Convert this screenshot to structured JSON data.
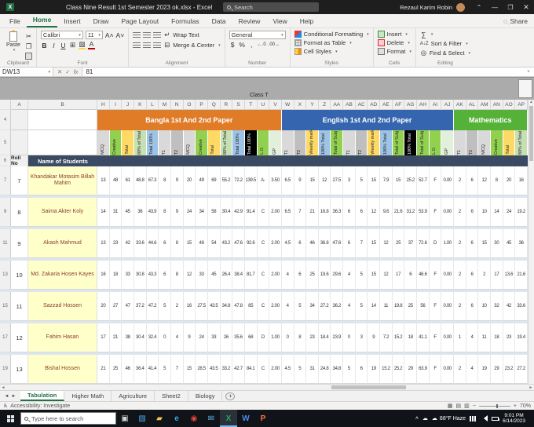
{
  "titlebar": {
    "title": "Class Nine Result 1st Semester 2023 ok.xlsx - Excel",
    "search": "Search",
    "user": "Rezaul Karim Robin"
  },
  "ribbon": {
    "tabs": [
      "File",
      "Home",
      "Insert",
      "Draw",
      "Page Layout",
      "Formulas",
      "Data",
      "Review",
      "View",
      "Help"
    ],
    "active_tab": "Home",
    "share_label": "Share",
    "group_labels": [
      "Clipboard",
      "Font",
      "Alignment",
      "Number",
      "Styles",
      "Cells",
      "Editing"
    ],
    "paste_label": "Paste",
    "font_name": "Calibri",
    "font_size": "11",
    "wrap_text_label": "Wrap Text",
    "merge_center_label": "Merge & Center",
    "number_format": "General",
    "cond_fmt_label": "Conditional Formatting",
    "format_table_label": "Format as Table",
    "cell_styles_label": "Cell Styles",
    "insert_label": "Insert",
    "delete_label": "Delete",
    "format_label": "Format",
    "sort_filter_label": "Sort & Filter",
    "find_select_label": "Find & Select"
  },
  "formula_bar": {
    "name_box": "DW13",
    "value": "81"
  },
  "sheet": {
    "left_cols": [
      "A",
      "B"
    ],
    "gutter_numbers": [
      "4",
      "5",
      "6"
    ],
    "floating_text": "Class T",
    "col_letters": [
      "H",
      "I",
      "J",
      "K",
      "L",
      "M",
      "N",
      "O",
      "P",
      "Q",
      "R",
      "S",
      "T",
      "U",
      "V",
      "W",
      "X",
      "Y",
      "Z",
      "AA",
      "AB",
      "AC",
      "AD",
      "AE",
      "AF",
      "AG",
      "AH",
      "AI",
      "AJ",
      "AK",
      "AL",
      "AM",
      "AN",
      "AO",
      "AP"
    ],
    "bands": [
      {
        "label": "Bangla 1st And 2nd Paper",
        "color": "#e07b28",
        "span": 15
      },
      {
        "label": "English 1st And 2nd Paper",
        "color": "#3565ae",
        "span": 14
      },
      {
        "label": "Mathematics",
        "color": "#55b138",
        "span": 6
      }
    ],
    "sub_headers": [
      {
        "label": "MCQ",
        "bg": "#d9d9d9"
      },
      {
        "label": "Creative",
        "bg": "#92d050"
      },
      {
        "label": "Total",
        "bg": "#ffd966"
      },
      {
        "label": "80% of Total",
        "bg": "#c6e0b4"
      },
      {
        "label": "Total 100%",
        "bg": "#9dc3e6"
      },
      {
        "label": "T1",
        "bg": "#d9d9d9"
      },
      {
        "label": "T2",
        "bg": "#bfbfbf"
      },
      {
        "label": "MCQ",
        "bg": "#d9d9d9"
      },
      {
        "label": "Creative",
        "bg": "#92d050"
      },
      {
        "label": "Total",
        "bg": "#ffd966"
      },
      {
        "label": "80% of Total",
        "bg": "#c6e0b4"
      },
      {
        "label": "Total 100%",
        "bg": "#9dc3e6"
      },
      {
        "label": "Total 100%",
        "bg": "#000000",
        "fg": "#ffffff"
      },
      {
        "label": "L.G",
        "bg": "#92d050"
      },
      {
        "label": "GP",
        "bg": "#e2efda"
      },
      {
        "label": "T1",
        "bg": "#d9d9d9"
      },
      {
        "label": "T2",
        "bg": "#bfbfbf"
      },
      {
        "label": "Weekly mark",
        "bg": "#ffd966"
      },
      {
        "label": "100% Total",
        "bg": "#9dc3e6"
      },
      {
        "label": "Total of Subj",
        "bg": "#92d050"
      },
      {
        "label": "T1",
        "bg": "#d9d9d9"
      },
      {
        "label": "T2",
        "bg": "#bfbfbf"
      },
      {
        "label": "Weekly mark",
        "bg": "#ffd966"
      },
      {
        "label": "100% Total",
        "bg": "#9dc3e6"
      },
      {
        "label": "Total of Subj",
        "bg": "#92d050"
      },
      {
        "label": "100% Total",
        "bg": "#000000",
        "fg": "#ffffff"
      },
      {
        "label": "Total of Subj",
        "bg": "#92d050"
      },
      {
        "label": "L.G",
        "bg": "#92d050"
      },
      {
        "label": "GP",
        "bg": "#e2efda"
      },
      {
        "label": "T1",
        "bg": "#d9d9d9"
      },
      {
        "label": "T2",
        "bg": "#bfbfbf"
      },
      {
        "label": "MCQ",
        "bg": "#d9d9d9"
      },
      {
        "label": "Creative",
        "bg": "#92d050"
      },
      {
        "label": "Total",
        "bg": "#ffd966"
      },
      {
        "label": "80% of Total",
        "bg": "#c6e0b4"
      }
    ],
    "header_row": {
      "roll": "Roll No",
      "name": "Name of Students"
    },
    "rows": [
      {
        "num": "7",
        "roll": "7",
        "name": "Khandakar Motasim Billah Mahim",
        "values": [
          13,
          48,
          61,
          48.8,
          67.3,
          8,
          9,
          20,
          49,
          69,
          55.2,
          72.2,
          139.5,
          "A-",
          "3.50",
          6.5,
          9,
          15,
          12,
          27.5,
          3,
          5,
          15,
          7.9,
          15,
          25.2,
          52.7,
          "F",
          "0.00",
          2,
          6,
          12,
          8,
          20,
          16
        ]
      },
      {
        "num": "9",
        "roll": "8",
        "name": "Saima Akter Koly",
        "values": [
          14,
          31,
          45,
          36,
          43.9,
          8,
          9,
          24,
          34,
          58,
          30.4,
          42.9,
          91.4,
          "C",
          "2.00",
          6.5,
          7,
          21,
          16.8,
          36.3,
          6,
          6,
          12,
          9.6,
          21.6,
          31.2,
          53.9,
          "F",
          "0.00",
          2,
          6,
          10,
          14,
          24,
          19.2
        ]
      },
      {
        "num": "11",
        "roll": "9",
        "name": "Akash Mahmud",
        "values": [
          13,
          23,
          42,
          33.6,
          44.6,
          6,
          8,
          15,
          48,
          54,
          43.2,
          47.6,
          92.6,
          "C",
          "2.00",
          4.5,
          6,
          46,
          36.8,
          47.6,
          6,
          7,
          15,
          12,
          25,
          37,
          72.6,
          "D",
          "1.00",
          2,
          6,
          15,
          30,
          45,
          36
        ]
      },
      {
        "num": "13",
        "roll": "10",
        "name": "Md. Zakaria Hosen Kayes",
        "values": [
          16,
          18,
          33,
          30.8,
          43.3,
          6,
          8,
          12,
          33,
          45,
          26.4,
          38.4,
          81.7,
          "C",
          "2.00",
          4,
          6,
          25,
          19.6,
          29.6,
          4,
          5,
          15,
          12,
          17,
          6,
          46.6,
          "F",
          "0.00",
          2,
          6,
          2,
          17,
          13.6,
          21.6
        ]
      },
      {
        "num": "15",
        "roll": "11",
        "name": "Sazzad Hossen",
        "values": [
          20,
          27,
          47,
          37.2,
          47.2,
          5,
          2,
          16,
          27.5,
          43.5,
          34.8,
          47.8,
          85,
          "C",
          "2.00",
          4,
          5,
          34,
          27.2,
          36.2,
          4,
          5,
          14,
          11,
          19.8,
          25,
          56,
          "F",
          "0.00",
          2,
          6,
          10,
          32,
          42,
          33.6
        ]
      },
      {
        "num": "17",
        "roll": "12",
        "name": "Fahim Hasan",
        "values": [
          17,
          21,
          38,
          30.4,
          32.4,
          0,
          4,
          9,
          24,
          33,
          26,
          35.6,
          68,
          "D",
          "1.00",
          0,
          8,
          23,
          18.4,
          23.9,
          0,
          3,
          9,
          7.2,
          15.2,
          18,
          41.1,
          "F",
          "0.00",
          1,
          4,
          11,
          18,
          23,
          19.4
        ]
      },
      {
        "num": "19",
        "roll": "13",
        "name": "Bishal Hossen",
        "values": [
          21,
          25,
          46,
          36.4,
          41.4,
          5,
          7,
          15,
          28.5,
          43.5,
          33.2,
          42.7,
          84.1,
          "C",
          "2.00",
          4.5,
          5,
          31,
          24.8,
          34.8,
          5,
          6,
          19,
          15.2,
          25.2,
          29,
          63.9,
          "F",
          "0.00",
          2,
          4,
          19,
          29,
          23.2,
          27.2
        ]
      }
    ]
  },
  "sheet_tabs": {
    "tabs": [
      "Tabulation",
      "Higher Math",
      "Agriculture",
      "Sheet2",
      "Biology"
    ],
    "active": "Tabulation"
  },
  "status_bar": {
    "accessibility": "Accessibility: Investigate",
    "zoom": "70%"
  },
  "taskbar": {
    "search_placeholder": "Type here to search",
    "icons": [
      {
        "name": "task-view-icon",
        "glyph": "▣",
        "color": "#d7d7d7"
      },
      {
        "name": "photos-icon",
        "glyph": "▧",
        "color": "#4fa3e3"
      },
      {
        "name": "folder-icon",
        "glyph": "▰",
        "color": "#f3c64b"
      },
      {
        "name": "edge-icon",
        "glyph": "e",
        "color": "#35aadc"
      },
      {
        "name": "chrome-icon",
        "glyph": "◉",
        "color": "#e8453c"
      },
      {
        "name": "mail-icon",
        "glyph": "✉",
        "color": "#5fb2e8"
      },
      {
        "name": "excel-icon",
        "glyph": "X",
        "color": "#21a366",
        "active": true
      },
      {
        "name": "word-icon",
        "glyph": "W",
        "color": "#4a8af4"
      },
      {
        "name": "powerpoint-icon",
        "glyph": "P",
        "color": "#ff7143"
      }
    ],
    "weather": "88°F Haze",
    "time": "9:01 PM",
    "date": "6/14/2023"
  }
}
